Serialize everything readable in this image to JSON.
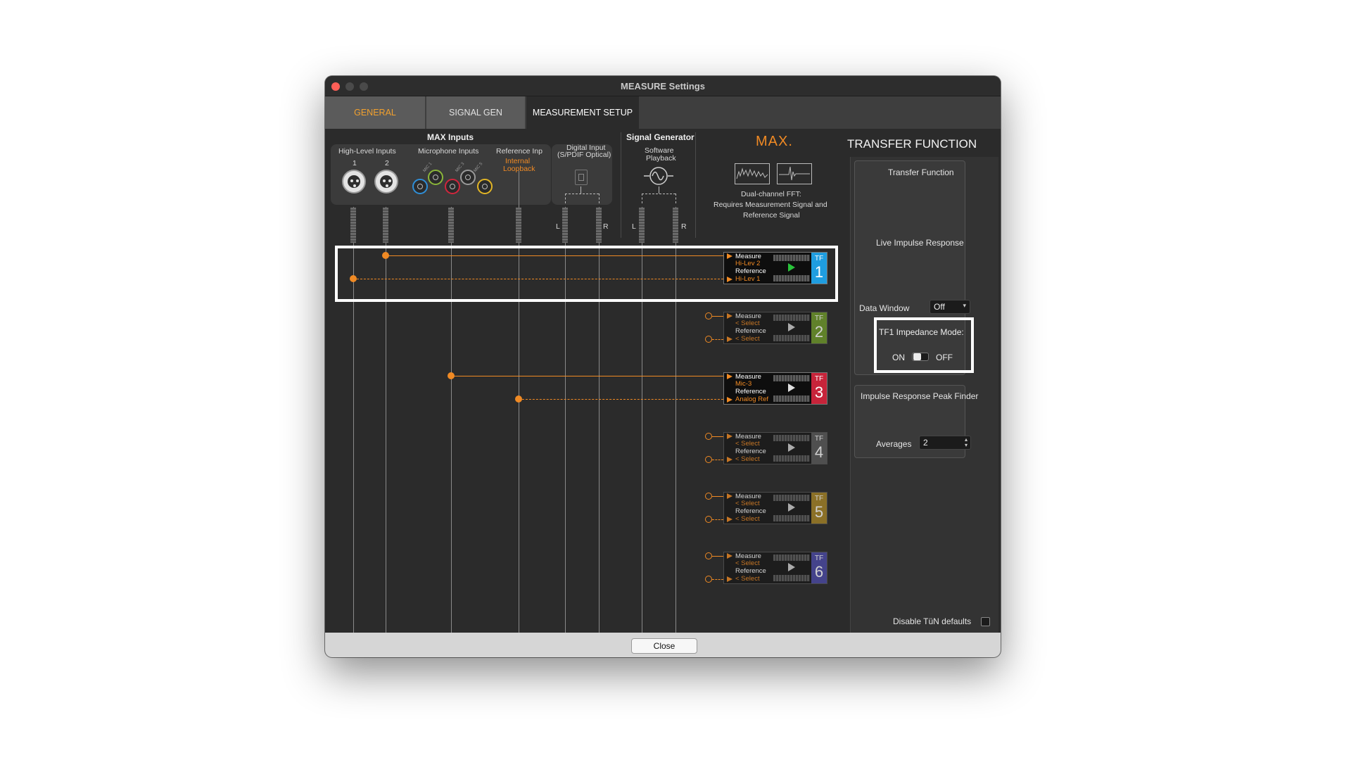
{
  "window": {
    "title": "MEASURE Settings",
    "close_label": "Close"
  },
  "tabs": [
    "GENERAL",
    "SIGNAL GEN",
    "MEASUREMENT SETUP"
  ],
  "colors": {
    "accent": "#f08a24",
    "tf1": "#1f9de0",
    "tf2": "#6f9a2a",
    "tf3": "#c7243a",
    "tf4": "#5a5a5a",
    "tf5": "#a78426",
    "tf6": "#4c4aa7"
  },
  "inputs": {
    "title": "MAX Inputs",
    "high_level": {
      "label": "High-Level Inputs",
      "ch1": "1",
      "ch2": "2"
    },
    "microphone": {
      "label": "Microphone Inputs"
    },
    "reference": {
      "label": "Reference Inp",
      "value_line1": "Internal",
      "value_line2": "Loopback"
    },
    "digital": {
      "label_line1": "Digital Input",
      "label_line2": "(S/PDIF Optical)",
      "left": "L",
      "right": "R"
    }
  },
  "signal_generator": {
    "title": "Signal Generator",
    "sub1": "Software",
    "sub2": "Playback",
    "left": "L",
    "right": "R"
  },
  "max_info": {
    "logo": "MAX.",
    "line1": "Dual-channel FFT:",
    "line2": "Requires Measurement Signal and",
    "line3": "Reference Signal"
  },
  "tf_rows": [
    {
      "measure_label": "Measure",
      "measure_value": "Hi-Lev 2",
      "reference_label": "Reference",
      "reference_value": "Hi-Lev 1",
      "tf": "TF",
      "num": "1"
    },
    {
      "measure_label": "Measure",
      "measure_value": "< Select",
      "reference_label": "Reference",
      "reference_value": "< Select",
      "tf": "TF",
      "num": "2"
    },
    {
      "measure_label": "Measure",
      "measure_value": "Mic-3",
      "reference_label": "Reference",
      "reference_value": "Analog Ref",
      "tf": "TF",
      "num": "3"
    },
    {
      "measure_label": "Measure",
      "measure_value": "< Select",
      "reference_label": "Reference",
      "reference_value": "< Select",
      "tf": "TF",
      "num": "4"
    },
    {
      "measure_label": "Measure",
      "measure_value": "< Select",
      "reference_label": "Reference",
      "reference_value": "< Select",
      "tf": "TF",
      "num": "5"
    },
    {
      "measure_label": "Measure",
      "measure_value": "< Select",
      "reference_label": "Reference",
      "reference_value": "< Select",
      "tf": "TF",
      "num": "6"
    }
  ],
  "right_panel": {
    "title": "TRANSFER FUNCTION",
    "transfer_function": "Transfer Function",
    "live_impulse": "Live Impulse Response",
    "data_window_label": "Data Window",
    "data_window_value": "Off",
    "impedance_label": "TF1 Impedance Mode:",
    "on_label": "ON",
    "off_label": "OFF",
    "peak_finder": "Impulse Response Peak Finder",
    "averages_label": "Averages",
    "averages_value": "2",
    "disable_defaults": "Disable TüN defaults"
  }
}
